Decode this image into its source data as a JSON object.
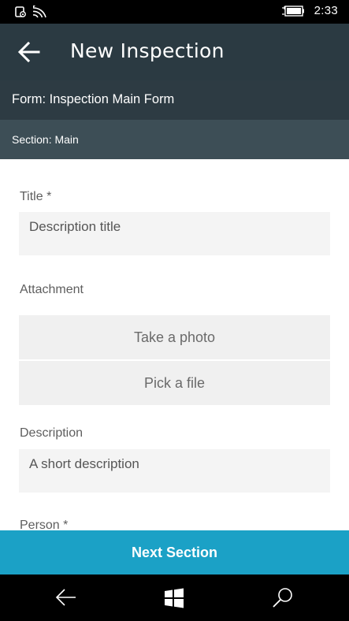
{
  "status_bar": {
    "time": "2:33",
    "icons": [
      "rotation-lock-icon",
      "wifi-icon",
      "battery-charging-icon"
    ]
  },
  "header": {
    "title": "New Inspection",
    "back_icon": "back-arrow-icon"
  },
  "form_bar": {
    "text": "Form: Inspection Main Form"
  },
  "section_bar": {
    "text": "Section: Main"
  },
  "fields": {
    "title": {
      "label": "Title *",
      "placeholder": "Description title"
    },
    "attachment": {
      "label": "Attachment",
      "take_photo": "Take a photo",
      "pick_file": "Pick a file"
    },
    "description": {
      "label": "Description",
      "placeholder": "A short description"
    },
    "person": {
      "label": "Person *"
    }
  },
  "next_button": {
    "label": "Next Section"
  },
  "nav_bar": {
    "icons": [
      "nav-back-icon",
      "windows-start-icon",
      "search-icon"
    ]
  },
  "colors": {
    "header": "#2b3a42",
    "section_bar": "#3d4e56",
    "accent": "#1ba1c6",
    "field_bg": "#f4f4f4"
  }
}
